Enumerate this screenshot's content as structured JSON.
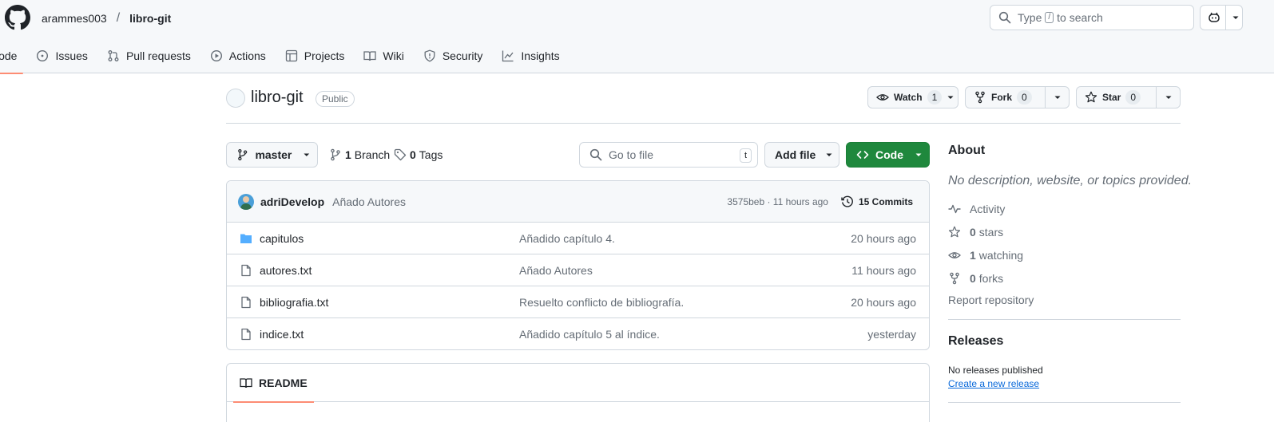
{
  "header": {
    "owner": "arammes003",
    "separator": "/",
    "repo": "libro-git",
    "search_placeholder_prefix": "Type",
    "search_key": "/",
    "search_placeholder_suffix": "to search"
  },
  "nav": {
    "tabs": [
      {
        "label": "Code",
        "icon": "code-icon",
        "active": true
      },
      {
        "label": "Issues",
        "icon": "issue-icon"
      },
      {
        "label": "Pull requests",
        "icon": "pull-request-icon"
      },
      {
        "label": "Actions",
        "icon": "play-icon"
      },
      {
        "label": "Projects",
        "icon": "table-icon"
      },
      {
        "label": "Wiki",
        "icon": "book-icon"
      },
      {
        "label": "Security",
        "icon": "shield-icon"
      },
      {
        "label": "Insights",
        "icon": "graph-icon"
      }
    ]
  },
  "repo": {
    "name": "libro-git",
    "visibility": "Public",
    "watch_label": "Watch",
    "watch_count": "1",
    "fork_label": "Fork",
    "fork_count": "0",
    "star_label": "Star",
    "star_count": "0"
  },
  "controls": {
    "branch": "master",
    "branches_count": "1",
    "branches_label": "Branch",
    "tags_count": "0",
    "tags_label": "Tags",
    "goto_placeholder": "Go to file",
    "goto_key": "t",
    "add_file": "Add file",
    "code": "Code"
  },
  "commit": {
    "author": "adriDevelop",
    "message": "Añado Autores",
    "sha_time": "3575beb · 11 hours ago",
    "commits_label": "15 Commits"
  },
  "files": [
    {
      "type": "folder",
      "name": "capitulos",
      "message": "Añadido capítulo 4.",
      "date": "20 hours ago"
    },
    {
      "type": "file",
      "name": "autores.txt",
      "message": "Añado Autores",
      "date": "11 hours ago"
    },
    {
      "type": "file",
      "name": "bibliografia.txt",
      "message": "Resuelto conflicto de bibliografía.",
      "date": "20 hours ago"
    },
    {
      "type": "file",
      "name": "indice.txt",
      "message": "Añadido capítulo 5 al índice.",
      "date": "yesterday"
    }
  ],
  "readme": {
    "tab_label": "README"
  },
  "sidebar": {
    "about_title": "About",
    "about_desc": "No description, website, or topics provided.",
    "activity_label": "Activity",
    "stars_count": "0",
    "stars_label": "stars",
    "watching_count": "1",
    "watching_label": "watching",
    "forks_count": "0",
    "forks_label": "forks",
    "report_label": "Report repository",
    "releases_title": "Releases",
    "releases_empty": "No releases published",
    "create_release": "Create a new release"
  },
  "colors": {
    "accent_underline": "#fd8c73",
    "code_button": "#1f883d",
    "folder_icon": "#54aeff",
    "link": "#0969da"
  }
}
